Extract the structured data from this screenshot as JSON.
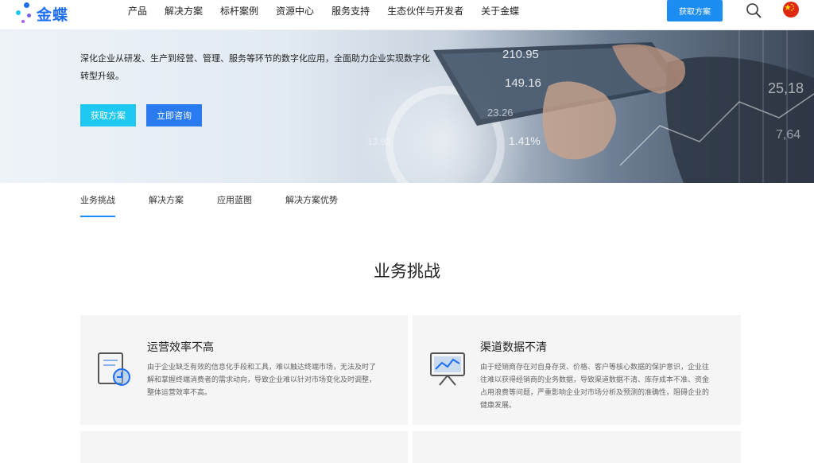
{
  "header": {
    "logo_text": "金蝶",
    "nav": [
      "产品",
      "解决方案",
      "标杆案例",
      "资源中心",
      "服务支持",
      "生态伙伴与开发者",
      "关于金蝶"
    ],
    "cta_label": "获取方案"
  },
  "hero": {
    "description": "深化企业从研发、生产到经营、管理、服务等环节的数字化应用，全面助力企业实现数字化转型升级。",
    "primary_button": "获取方案",
    "secondary_button": "立即咨询",
    "numbers": [
      "210.95",
      "149.16",
      "23.26",
      "13.92",
      "1.41%",
      "25,18",
      "7,64"
    ]
  },
  "tabs": [
    "业务挑战",
    "解决方案",
    "应用蓝图",
    "解决方案优势"
  ],
  "section": {
    "title": "业务挑战",
    "cards": [
      {
        "title": "运营效率不高",
        "text": "由于企业缺乏有效的信息化手段和工具，难以触达终端市场，无法及时了解和掌握终端消费者的需求动向，导致企业难以针对市场变化及时调整，整体运营效率不高。",
        "icon": "efficiency-doc-icon"
      },
      {
        "title": "渠道数据不清",
        "text": "由于经销商存在对自身存货、价格、客户等核心数据的保护意识，企业往往难以获得经销商的业务数据，导致渠道数据不清、库存成本不准、资金占用浪费等问题，严重影响企业对市场分析及预测的准确性，阻碍企业的健康发展。",
        "icon": "chart-board-icon"
      }
    ]
  },
  "colors": {
    "brand": "#1e6ef2",
    "cta": "#1e8df2",
    "cyan": "#1ec8f0"
  }
}
